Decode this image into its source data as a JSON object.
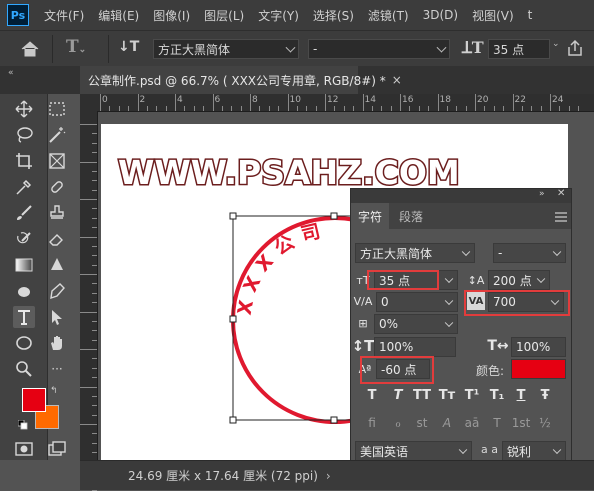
{
  "app": {
    "logo": "Ps"
  },
  "menu": [
    "文件(F)",
    "编辑(E)",
    "图像(I)",
    "图层(L)",
    "文字(Y)",
    "选择(S)",
    "滤镜(T)",
    "3D(D)",
    "视图(V)",
    "t"
  ],
  "options": {
    "font_family": "方正大黑简体",
    "font_style": "-",
    "font_size": "35 点"
  },
  "document_tab": {
    "title": "公章制作.psd @ 66.7% ( XXX公司专用章, RGB/8#) *",
    "close": "×"
  },
  "ruler": {
    "h_labels": [
      "0",
      "2",
      "4",
      "6",
      "8",
      "10",
      "12",
      "14",
      "16",
      "18",
      "20",
      "22",
      "24"
    ]
  },
  "canvas": {
    "watermark": "WWW.PSAHZ.COM",
    "stamp_text": "XXX公司"
  },
  "status": {
    "dimensions": "24.69 厘米 x 17.64 厘米 (72 ppi)"
  },
  "character_panel": {
    "tab_character": "字符",
    "tab_paragraph": "段落",
    "font_family": "方正大黑简体",
    "font_style": "-",
    "size": "35 点",
    "leading": "200 点",
    "kerning": "0",
    "tracking": "700",
    "scale_percent": "0%",
    "vertical_scale": "100%",
    "horizontal_scale": "100%",
    "baseline_shift": "-60 点",
    "color_label": "颜色:",
    "color": "#e60012",
    "language": "美国英语",
    "aa_label": "a a",
    "antialias": "锐利",
    "style_buttons": [
      "T",
      "T",
      "TT",
      "Tт",
      "T¹",
      "T₁",
      "T",
      "Ŧ"
    ],
    "opentype_buttons": [
      "fi",
      "ℴ",
      "st",
      "A",
      "aā",
      "T",
      "1st",
      "½"
    ]
  },
  "colors": {
    "foreground": "#e60012",
    "background": "#ff6a00",
    "highlight": "#e23c3c",
    "stamp": "#e0192f"
  }
}
